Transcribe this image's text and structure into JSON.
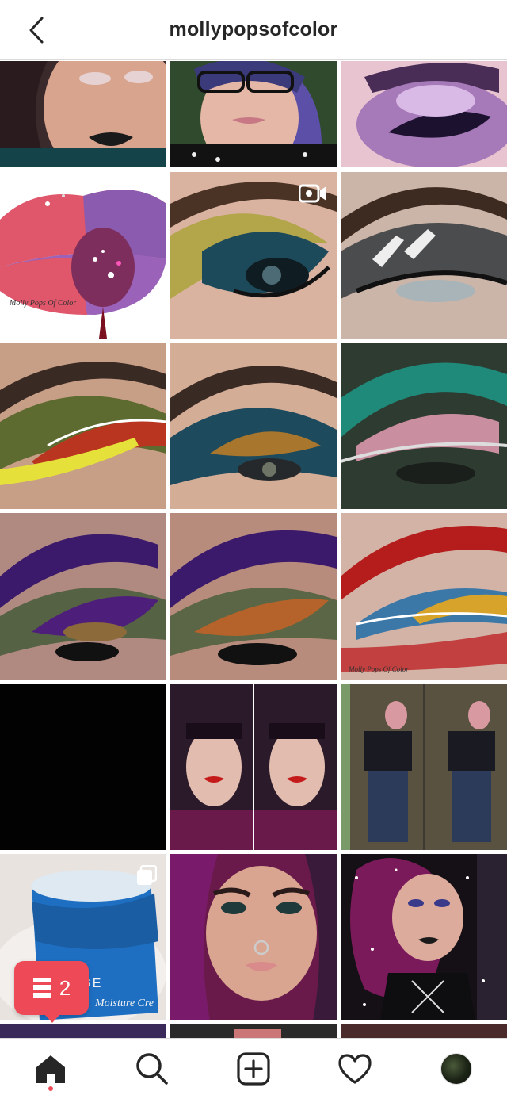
{
  "header": {
    "title": "mollypopsofcolor",
    "back_icon": "chevron-left-icon"
  },
  "grid": {
    "tiles": [
      {
        "name": "post-1",
        "subject": "portrait-black-lipstick",
        "icon": null
      },
      {
        "name": "post-2",
        "subject": "portrait-glasses",
        "icon": null
      },
      {
        "name": "post-3",
        "subject": "purple-eye-look",
        "icon": null
      },
      {
        "name": "post-4",
        "subject": "glitter-lips",
        "icon": null,
        "caption": "Molly Pops Of Color"
      },
      {
        "name": "post-5",
        "subject": "green-teal-eye",
        "icon": "video-icon"
      },
      {
        "name": "post-6",
        "subject": "gray-cut-crease-eye",
        "icon": null
      },
      {
        "name": "post-7",
        "subject": "olive-red-eye",
        "icon": null
      },
      {
        "name": "post-8",
        "subject": "bronze-teal-eye",
        "icon": null
      },
      {
        "name": "post-9",
        "subject": "teal-pink-eye",
        "icon": null
      },
      {
        "name": "post-10",
        "subject": "purple-glitter-eye",
        "icon": null
      },
      {
        "name": "post-11",
        "subject": "purple-bronze-eye",
        "icon": null
      },
      {
        "name": "post-12",
        "subject": "rainbow-red-brow-eye",
        "icon": null,
        "caption": "Molly Pops Of Color"
      },
      {
        "name": "post-13",
        "subject": "black-image",
        "icon": null
      },
      {
        "name": "post-14",
        "subject": "red-lips-portraits",
        "icon": null
      },
      {
        "name": "post-15",
        "subject": "mirror-selfies",
        "icon": null
      },
      {
        "name": "post-16",
        "subject": "laneige-moisture-cream",
        "icon": "carousel-icon",
        "brand": "LANEIGE",
        "product": "Moisture Cre"
      },
      {
        "name": "post-17",
        "subject": "portrait-septum-piercing",
        "icon": null
      },
      {
        "name": "post-18",
        "subject": "sparkle-portrait",
        "icon": null
      }
    ]
  },
  "notification": {
    "icon": "activity-list-icon",
    "count": "2"
  },
  "bottom_nav": {
    "items": [
      {
        "name": "home",
        "icon": "home-icon",
        "active": true
      },
      {
        "name": "search",
        "icon": "search-icon",
        "active": false
      },
      {
        "name": "new-post",
        "icon": "plus-square-icon",
        "active": false
      },
      {
        "name": "activity",
        "icon": "heart-icon",
        "active": false
      },
      {
        "name": "profile",
        "icon": "avatar",
        "active": false
      }
    ]
  },
  "colors": {
    "accent": "#ed4956",
    "text": "#262626",
    "divider": "#dbdbdb"
  }
}
